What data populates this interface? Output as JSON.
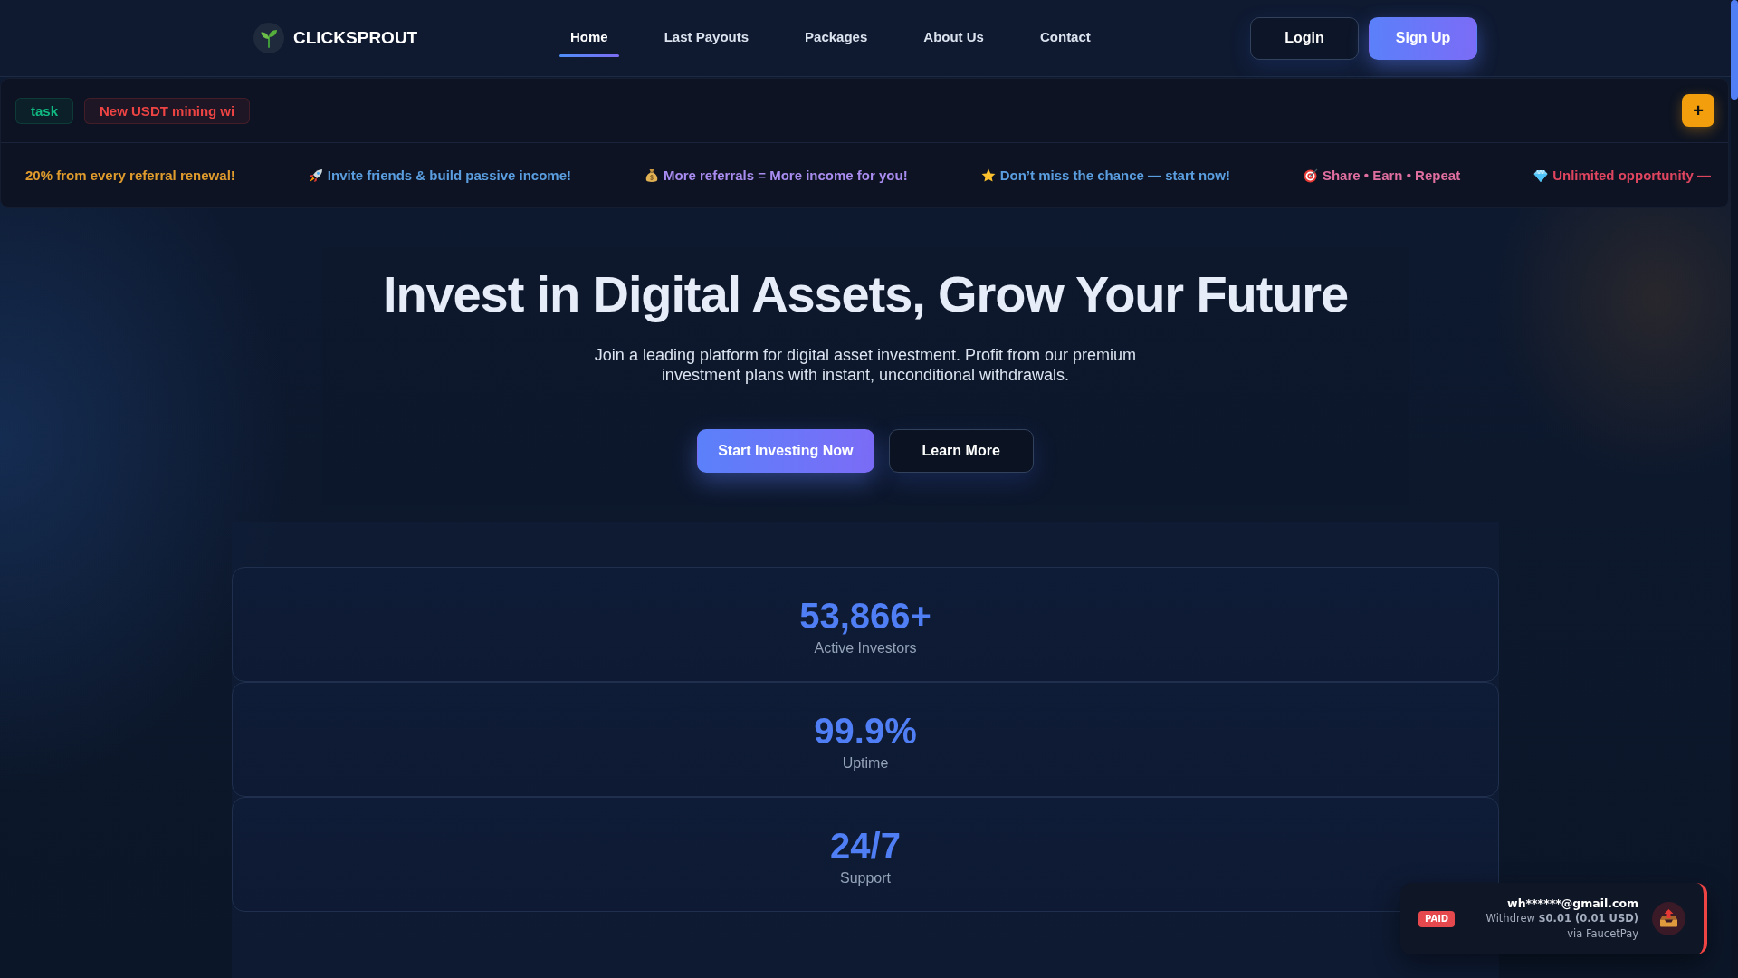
{
  "header": {
    "logo": {
      "text": "CLICKSPROUT"
    },
    "nav": [
      {
        "label": "Home",
        "selected": true
      },
      {
        "label": "Last Payouts",
        "selected": false
      },
      {
        "label": "Packages",
        "selected": false
      },
      {
        "label": "About Us",
        "selected": false
      },
      {
        "label": "Contact",
        "selected": false
      }
    ],
    "buttons": [
      {
        "label": "Login",
        "kind": "outline"
      },
      {
        "label": "Sign Up",
        "kind": "primary"
      }
    ]
  },
  "announcements": {
    "tags": [
      {
        "label": "task",
        "color": "#10b981"
      },
      {
        "label": "New USDT mining wi",
        "color": "#ef4444"
      }
    ],
    "add_button": {
      "label": "+"
    },
    "ticker": [
      {
        "text": "20% from every referral renewal!",
        "color": "#e09b2d"
      },
      {
        "text": "Invite friends & build passive income!",
        "color": "#5b9ee0"
      },
      {
        "text": "More referrals = More income for you!",
        "color": "#a98cf0"
      },
      {
        "text": "Don’t miss the chance — start now!",
        "color": "#5b9ee0"
      },
      {
        "text": "Share • Earn • Repeat",
        "color": "#e06fa0"
      },
      {
        "text": "Unlimited opportunity —",
        "color": "#e04560"
      }
    ]
  },
  "hero": {
    "title": "Invest in Digital Assets, Grow Your Future",
    "subtitle": "Join a leading platform for digital asset investment. Profit from our premium investment plans with instant, unconditional withdrawals.",
    "buttons": [
      {
        "label": "Start Investing Now",
        "kind": "primary"
      },
      {
        "label": "Learn More",
        "kind": "outline"
      }
    ]
  },
  "stats": [
    {
      "value": "53,866+",
      "label": "Active Investors"
    },
    {
      "value": "99.9%",
      "label": "Uptime"
    },
    {
      "value": "24/7",
      "label": "Support"
    }
  ],
  "toast": {
    "badge": "PAID",
    "email": "wh******@gmail.com",
    "message": "Withdrew **$0.01 (0.01 USD)**",
    "via": "via FaucetPay"
  }
}
